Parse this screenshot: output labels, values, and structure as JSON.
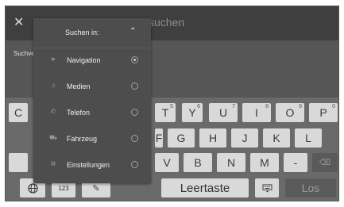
{
  "header": {
    "close_icon": "close-icon",
    "search_text": "suchen"
  },
  "history": {
    "label": "Suchve"
  },
  "dropdown": {
    "title": "Suchen in:",
    "items": [
      {
        "label": "Navigation",
        "icon": "navigation-arrow-icon",
        "selected": true
      },
      {
        "label": "Medien",
        "icon": "music-note-icon",
        "selected": false
      },
      {
        "label": "Telefon",
        "icon": "phone-icon",
        "selected": false
      },
      {
        "label": "Fahrzeug",
        "icon": "car-icon",
        "selected": false
      },
      {
        "label": "Einstellungen",
        "icon": "gear-icon",
        "selected": false
      }
    ]
  },
  "keyboard": {
    "row1": [
      {
        "label": "C",
        "sup": ""
      },
      {
        "label": "T",
        "sup": "5"
      },
      {
        "label": "Y",
        "sup": "6"
      },
      {
        "label": "U",
        "sup": "7"
      },
      {
        "label": "I",
        "sup": "8"
      },
      {
        "label": "O",
        "sup": "9"
      },
      {
        "label": "P",
        "sup": "0"
      }
    ],
    "row2": [
      "F",
      "G",
      "H",
      "J",
      "K",
      "L"
    ],
    "row3": [
      "V",
      "B",
      "N",
      "M",
      "-"
    ],
    "num_key": "123",
    "space_key": "Leertaste",
    "go_key": "Los"
  }
}
